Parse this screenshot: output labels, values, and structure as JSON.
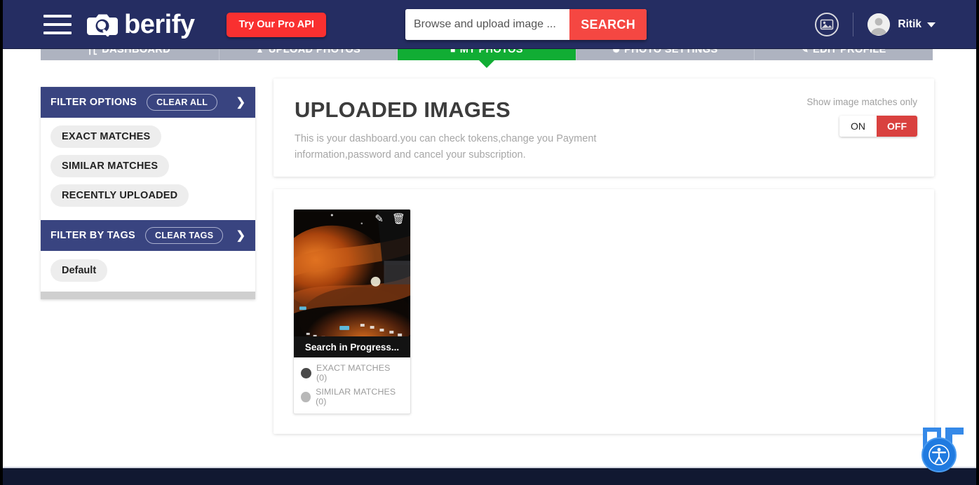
{
  "header": {
    "menu_icon": "hamburger-icon",
    "brand": "berify",
    "brand_logo_icon": "camera-search-logo-icon",
    "pro_button": "Try Our Pro API",
    "search": {
      "placeholder": "Browse and upload image ...",
      "value": "",
      "button": "SEARCH"
    },
    "image_icon": "photo-circle-icon",
    "user": {
      "avatar_icon": "user-avatar-icon",
      "name": "Ritik",
      "caret_icon": "chevron-down-icon"
    }
  },
  "nav": {
    "tabs": [
      {
        "label": "DASHBOARD",
        "icon": "bar-chart-icon",
        "active": false
      },
      {
        "label": "UPLOAD PHOTOS",
        "icon": "upload-icon",
        "active": false
      },
      {
        "label": "MY PHOTOS",
        "icon": "photos-icon",
        "active": true
      },
      {
        "label": "PHOTO SETTINGS",
        "icon": "gear-icon",
        "active": false
      },
      {
        "label": "EDIT PROFILE",
        "icon": "pencil-icon",
        "active": false
      }
    ]
  },
  "sidebar": {
    "filter_options": {
      "title": "FILTER OPTIONS",
      "clear_label": "CLEAR ALL",
      "chevron_icon": "chevron-right-icon",
      "items": [
        {
          "label": "EXACT MATCHES"
        },
        {
          "label": "SIMILAR MATCHES"
        },
        {
          "label": "RECENTLY UPLOADED"
        }
      ]
    },
    "filter_by_tags": {
      "title": "FILTER BY TAGS",
      "clear_label": "CLEAR TAGS",
      "chevron_icon": "chevron-right-icon",
      "tags": [
        {
          "label": "Default"
        }
      ]
    }
  },
  "main": {
    "title": "UPLOADED IMAGES",
    "subtitle": "This is your dashboard.you can check tokens,change you Payment information,password and cancel your subscription.",
    "toggle": {
      "label": "Show image matches only",
      "on_label": "ON",
      "off_label": "OFF",
      "selected": "OFF"
    },
    "cards": [
      {
        "edit_icon": "pencil-icon",
        "delete_icon": "trash-icon",
        "status": "Search in Progress...",
        "exact_matches": "EXACT MATCHES (0)",
        "exact_icon": "globe-dark-icon",
        "similar_matches": "SIMILAR MATCHES (0)",
        "similar_icon": "globe-light-icon"
      }
    ]
  },
  "overlays": {
    "accessibility_icon": "accessibility-icon",
    "watermark_icon": "brand-watermark-icon"
  },
  "colors": {
    "header_navy": "#252d62",
    "sidebar_header_navy": "#394480",
    "accent_red": "#f93030",
    "search_red": "#f54742",
    "active_green": "#11ad34",
    "toggle_off_red": "#d9413f",
    "nav_gray": "#aeb3c0",
    "footer_navy": "#111831"
  }
}
